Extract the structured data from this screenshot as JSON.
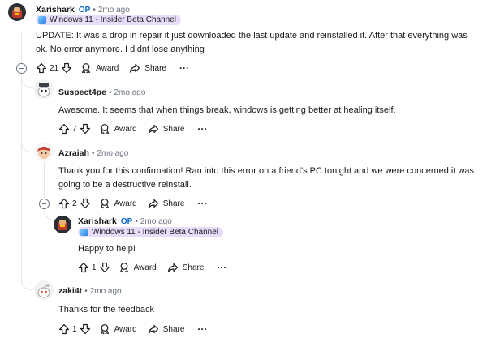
{
  "comments": [
    {
      "author": "Xarishark",
      "op_badge": "OP",
      "separator": "•",
      "time": "2mo ago",
      "flair": "Windows 11 - Insider Beta Channel",
      "body": "UPDATE: It was a drop in repair it just downloaded the last update and reinstalled it. After that everything was ok. No error anymore. I didnt lose anything",
      "votes": "21",
      "award_label": "Award",
      "share_label": "Share"
    },
    {
      "author": "Suspect4pe",
      "separator": "•",
      "time": "2mo ago",
      "body": "Awesome. It seems that when things break, windows is getting better at healing itself.",
      "votes": "7",
      "award_label": "Award",
      "share_label": "Share"
    },
    {
      "author": "Azraiah",
      "separator": "•",
      "time": "2mo ago",
      "body": "Thank you for this confirmation! Ran into this error on a friend's PC tonight and we were concerned it was going to be a destructive reinstall.",
      "votes": "2",
      "award_label": "Award",
      "share_label": "Share"
    },
    {
      "author": "Xarishark",
      "op_badge": "OP",
      "separator": "•",
      "time": "2mo ago",
      "flair": "Windows 11 - Insider Beta Channel",
      "body": "Happy to help!",
      "votes": "1",
      "award_label": "Award",
      "share_label": "Share"
    },
    {
      "author": "zaki4t",
      "separator": "•",
      "time": "2mo ago",
      "body": "Thanks for the feedback",
      "votes": "1",
      "award_label": "Award",
      "share_label": "Share"
    }
  ],
  "icons": {
    "upvote": "arrow-up-icon",
    "downvote": "arrow-down-icon",
    "award": "award-icon",
    "share": "share-icon",
    "more": "more-options-icon",
    "collapse": "collapse-thread-icon"
  },
  "colors": {
    "op_badge": "#0a66c2",
    "flair_bg": "#e7ddfb",
    "meta_text": "#6b7280",
    "thread_line": "#e5e7eb"
  }
}
